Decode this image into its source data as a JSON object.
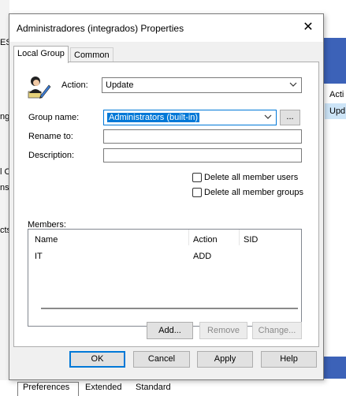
{
  "background": {
    "left_fragments": [
      "ES",
      "ng",
      "l C",
      "ns",
      "cts"
    ],
    "right_fragments": [
      "Acti",
      "Upd"
    ]
  },
  "dialog": {
    "title": "Administradores (integrados) Properties",
    "close_glyph": "✕",
    "tabs": [
      "Local Group",
      "Common"
    ],
    "action_label": "Action:",
    "action_value": "Update",
    "group_name_label": "Group name:",
    "group_name_value": "Administrators (built-in)",
    "browse_label": "...",
    "rename_label": "Rename to:",
    "rename_value": "",
    "description_label": "Description:",
    "description_value": "",
    "delete_users_label": "Delete all member users",
    "delete_groups_label": "Delete all member groups",
    "members_label": "Members:",
    "members_columns": [
      "Name",
      "Action",
      "SID"
    ],
    "members_rows": [
      {
        "name": "IT",
        "action": "ADD",
        "sid": ""
      }
    ],
    "add_button": "Add...",
    "remove_button": "Remove",
    "change_button": "Change...",
    "ok_button": "OK",
    "cancel_button": "Cancel",
    "apply_button": "Apply",
    "help_button": "Help"
  },
  "bottom_tabs": [
    "Preferences",
    "Extended",
    "Standard"
  ],
  "colors": {
    "accent": "#0078d7",
    "background_blue": "#3c62b8",
    "dialog_face": "#f0f0f0"
  },
  "icons": {
    "group_policy_icon": "user-with-pen-icon"
  }
}
